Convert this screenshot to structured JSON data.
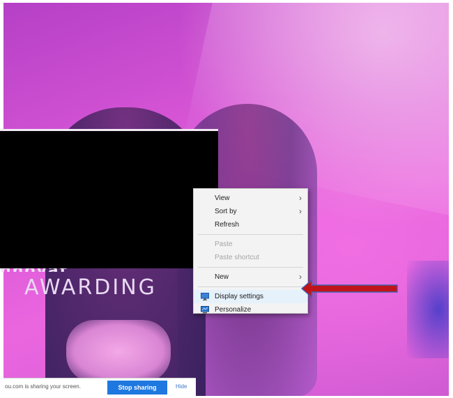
{
  "poster": {
    "line1": "nnovat",
    "line2": "AWARDING"
  },
  "context_menu": {
    "group1": [
      {
        "label": "View",
        "submenu": true
      },
      {
        "label": "Sort by",
        "submenu": true
      },
      {
        "label": "Refresh",
        "submenu": false
      }
    ],
    "group2": [
      {
        "label": "Paste",
        "disabled": true
      },
      {
        "label": "Paste shortcut",
        "disabled": true
      }
    ],
    "group3": [
      {
        "label": "New",
        "submenu": true
      }
    ],
    "group4": [
      {
        "label": "Display settings",
        "icon": "display-settings-icon"
      },
      {
        "label": "Personalize",
        "icon": "personalize-icon"
      }
    ]
  },
  "share_bar": {
    "text": "ou.com is sharing your screen.",
    "stop_label": "Stop sharing",
    "hide_label": "Hide"
  },
  "colors": {
    "arrow": "#c0141a",
    "stop_button": "#1e78e0"
  }
}
